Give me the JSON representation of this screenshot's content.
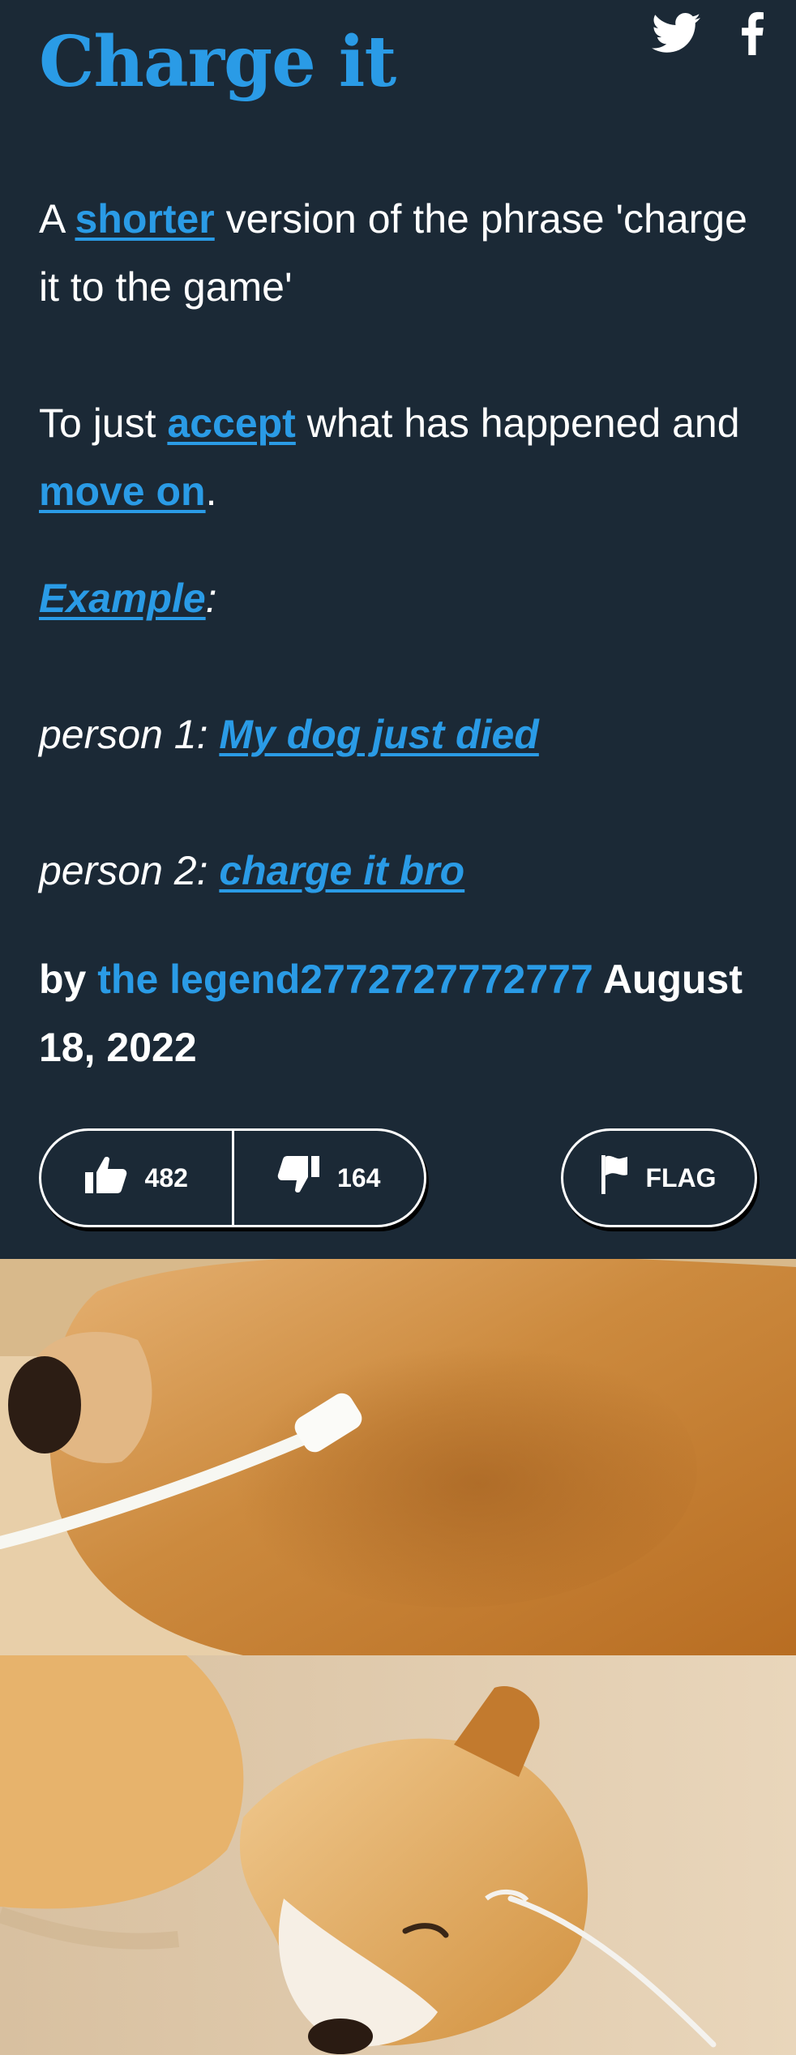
{
  "entry": {
    "title": "Charge it",
    "meaning": {
      "p1_prefix": "A ",
      "p1_link": "shorter",
      "p1_suffix": " version of the phrase 'charge it to the game'",
      "p2_prefix": "To just ",
      "p2_link1": "accept",
      "p2_middle": " what has happened and ",
      "p2_link2": "move on",
      "p2_suffix": "."
    },
    "example": {
      "label": "Example",
      "label_suffix": ":",
      "line1_speaker": "person 1: ",
      "line1_link": "My dog just died",
      "line2_speaker": "person 2: ",
      "line2_link": "charge it bro"
    },
    "byline": {
      "by": "by ",
      "author": "the legend2772727772777",
      "date": " August 18, 2022"
    },
    "actions": {
      "upvotes": "482",
      "downvotes": "164",
      "flag_label": "FLAG"
    }
  },
  "share": {
    "icons": [
      "twitter-icon",
      "facebook-icon"
    ]
  },
  "colors": {
    "background": "#1b2936",
    "accent": "#2a9be6",
    "text": "#ffffff"
  }
}
